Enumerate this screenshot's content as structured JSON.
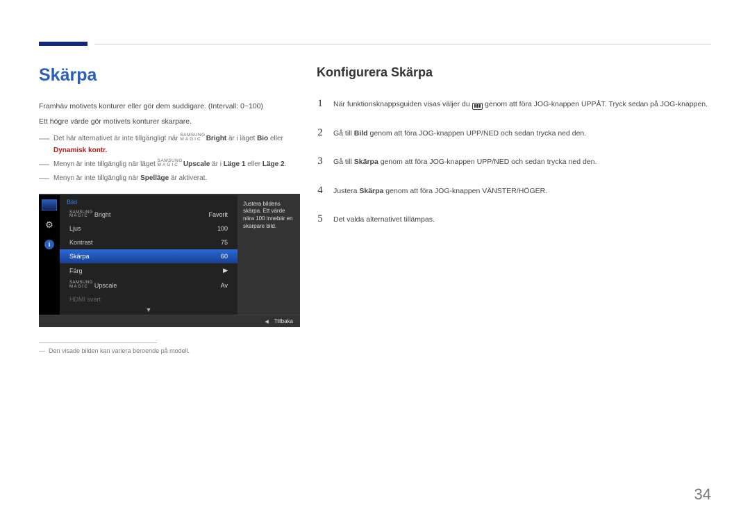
{
  "header": {},
  "left": {
    "title": "Skärpa",
    "intro1": "Framhäv motivets konturer eller gör dem suddigare. (Intervall: 0~100)",
    "intro2": "Ett högre värde gör motivets konturer skarpare.",
    "notes": [
      {
        "prefix": "Det här alternativet är inte tillgängligt när ",
        "brand": "Bright",
        "mid": " är i läget ",
        "b1": "Bio",
        "or": " eller ",
        "b2": "Dynamisk kontr.",
        "suffix": ""
      },
      {
        "prefix": "Menyn är inte tillgänglig när läget ",
        "brand": "Upscale",
        "mid": " är i ",
        "b1": "Läge 1",
        "or": " eller ",
        "b2": "Läge 2",
        "suffix": "."
      },
      {
        "prefix": "Menyn är inte tillgänglig när ",
        "b1": "Spelläge",
        "mid": " är aktiverat.",
        "plain": true
      }
    ],
    "footnote": "Den visade bilden kan variera beroende på modell."
  },
  "osd": {
    "title": "Bild",
    "rows": [
      {
        "label": "Bright",
        "brand": true,
        "value": "Favorit"
      },
      {
        "label": "Ljus",
        "value": "100"
      },
      {
        "label": "Kontrast",
        "value": "75"
      },
      {
        "label": "Skärpa",
        "value": "60",
        "selected": true
      },
      {
        "label": "Färg",
        "value": "▶"
      },
      {
        "label": "Upscale",
        "brand": true,
        "value": "Av"
      },
      {
        "label": "HDMI svart",
        "value": "",
        "disabled": true
      }
    ],
    "desc": "Justera bildens skärpa. Ett värde nära 100 innebär en skarpare bild.",
    "footer_back": "Tillbaka"
  },
  "right": {
    "title": "Konfigurera Skärpa",
    "steps": [
      {
        "pre": "När funktionsknappsguiden visas väljer du ",
        "post": " genom att föra JOG-knappen UPPÅT. Tryck sedan på JOG-knappen.",
        "has_icon": true
      },
      {
        "pre": "Gå till ",
        "bold": "Bild",
        "post": " genom att föra JOG-knappen UPP/NED och sedan trycka ned den."
      },
      {
        "pre": "Gå till ",
        "bold": "Skärpa",
        "post": " genom att föra JOG-knappen UPP/NED och sedan trycka ned den."
      },
      {
        "pre": "Justera ",
        "bold": "Skärpa",
        "post": " genom att föra JOG-knappen VÄNSTER/HÖGER."
      },
      {
        "pre": "Det valda alternativet tillämpas."
      }
    ]
  },
  "page_number": "34",
  "samsung": "SAMSUNG",
  "magic": "MAGIC"
}
